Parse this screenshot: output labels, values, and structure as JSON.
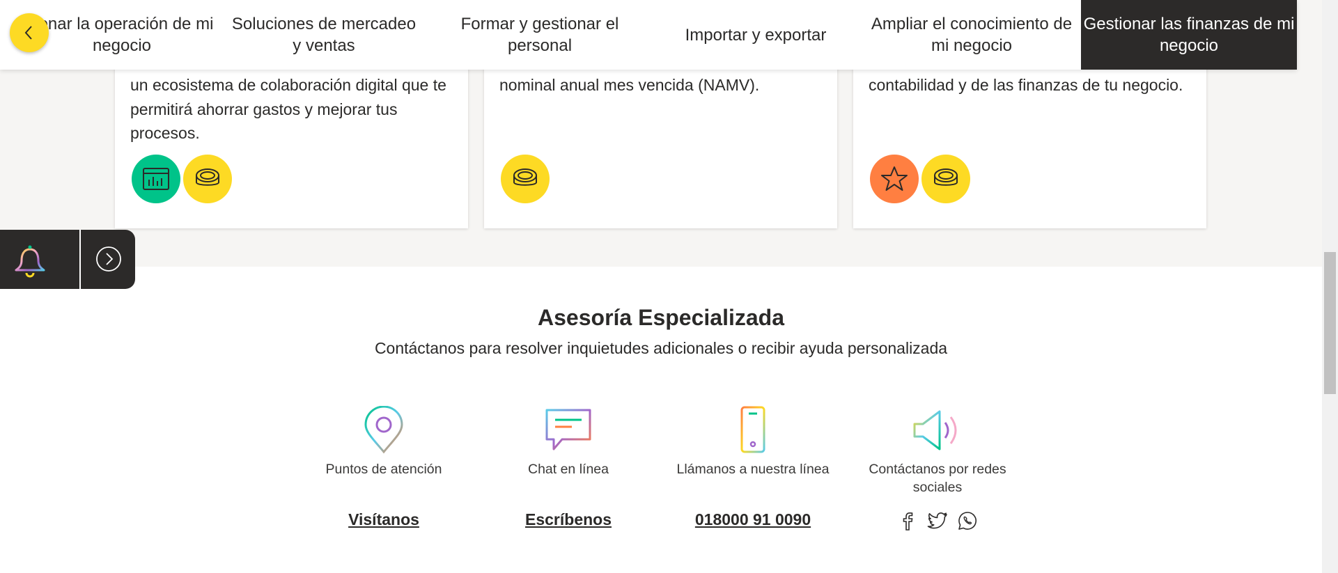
{
  "nav": {
    "prev_icon": "chevron-left-icon",
    "tabs": [
      {
        "label": "tionar la operación de mi negocio"
      },
      {
        "label": "Soluciones de mercadeo y ventas"
      },
      {
        "label": "Formar y gestionar el personal"
      },
      {
        "label": "Importar y exportar"
      },
      {
        "label": "Ampliar el conocimiento de mi negocio"
      },
      {
        "label": "Gestionar las finanzas de mi negocio"
      }
    ]
  },
  "cards": [
    {
      "text": "un ecosistema de colaboración digital que te permitirá ahorrar gastos y mejorar tus procesos.",
      "badges": [
        "dashboard-icon",
        "coins-icon"
      ]
    },
    {
      "text": "nominal anual mes vencida (NAMV).",
      "badges": [
        "coins-icon"
      ]
    },
    {
      "text": "contabilidad y de las finanzas de tu negocio.",
      "badges": [
        "star-icon",
        "coins-icon"
      ]
    }
  ],
  "widget": {
    "left_icon": "bell-icon",
    "right_icon": "chevron-right-circle-icon"
  },
  "advisory": {
    "title": "Asesoría Especializada",
    "subtitle": "Contáctanos para resolver inquietudes adicionales o recibir ayuda personalizada",
    "items": [
      {
        "label": "Puntos de atención",
        "link": "Visítanos",
        "icon": "location-pin-icon"
      },
      {
        "label": "Chat en línea",
        "link": "Escríbenos",
        "icon": "chat-bubble-icon"
      },
      {
        "label": "Llámanos a nuestra línea",
        "link": "018000 91 0090",
        "icon": "mobile-phone-icon"
      },
      {
        "label": "Contáctanos por redes sociales",
        "icon": "megaphone-icon",
        "social": [
          "facebook-icon",
          "twitter-icon",
          "whatsapp-icon"
        ]
      }
    ]
  },
  "colors": {
    "yellow": "#fdda24",
    "green": "#00c389",
    "orange": "#ff7f41",
    "dark": "#2c2a29"
  }
}
